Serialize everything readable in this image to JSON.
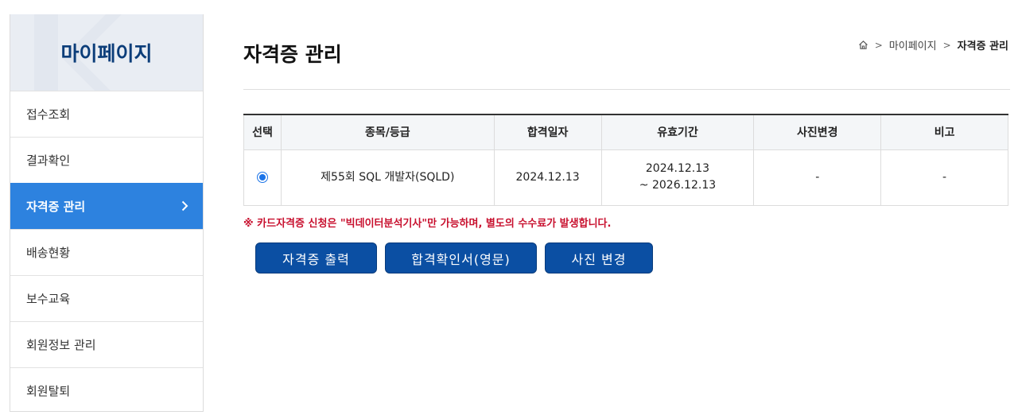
{
  "sidebar": {
    "title": "마이페이지",
    "items": [
      {
        "label": "접수조회",
        "active": false
      },
      {
        "label": "결과확인",
        "active": false
      },
      {
        "label": "자격증 관리",
        "active": true
      },
      {
        "label": "배송현황",
        "active": false
      },
      {
        "label": "보수교육",
        "active": false
      },
      {
        "label": "회원정보 관리",
        "active": false
      },
      {
        "label": "회원탈퇴",
        "active": false
      }
    ]
  },
  "page": {
    "title": "자격증 관리"
  },
  "breadcrumb": {
    "level1": "마이페이지",
    "current": "자격증 관리"
  },
  "table": {
    "headers": [
      "선택",
      "종목/등급",
      "합격일자",
      "유효기간",
      "사진변경",
      "비고"
    ],
    "rows": [
      {
        "selected": true,
        "item": "제55회 SQL 개발자(SQLD)",
        "pass_date": "2024.12.13",
        "valid_from": "2024.12.13",
        "valid_to": "~ 2026.12.13",
        "photo_change": "-",
        "remarks": "-"
      }
    ]
  },
  "notice": "※ 카드자격증 신청은 \"빅데이터분석기사\"만 가능하며, 별도의 수수료가 발생합니다.",
  "buttons": {
    "print": "자격증 출력",
    "confirm_en": "합격확인서(영문)",
    "photo": "사진 변경"
  },
  "colors": {
    "brand_navy": "#0b3d79",
    "active_menu": "#2d82df",
    "button": "#0b4fa3",
    "notice_red": "#c8102e"
  }
}
